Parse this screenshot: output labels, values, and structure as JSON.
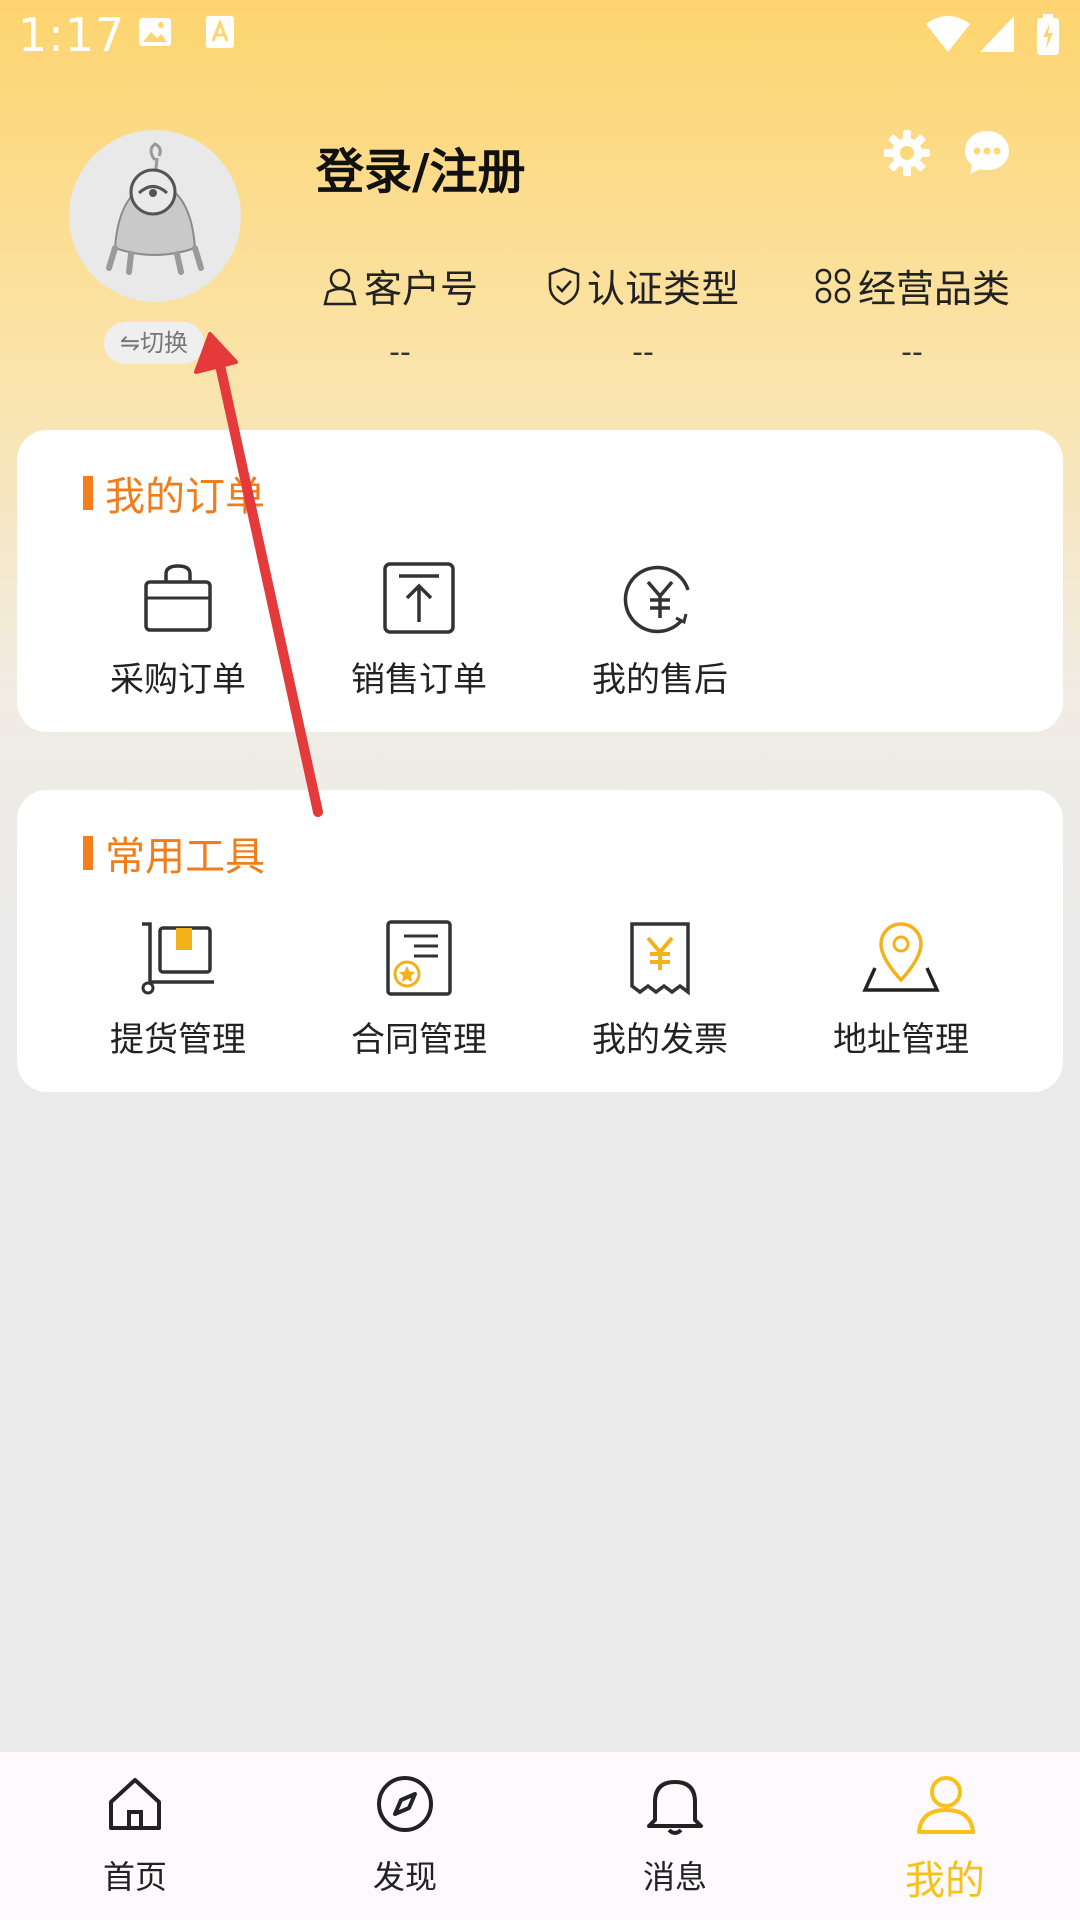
{
  "status_bar": {
    "time": "1:17"
  },
  "profile": {
    "login_label": "登录/注册",
    "switch_label": "⇋切换",
    "stats": [
      {
        "label": "客户号",
        "value": "--",
        "icon": "user-icon"
      },
      {
        "label": "认证类型",
        "value": "--",
        "icon": "shield-check-icon"
      },
      {
        "label": "经营品类",
        "value": "--",
        "icon": "grid-icon"
      }
    ]
  },
  "orders": {
    "title": "我的订单",
    "items": [
      {
        "label": "采购订单",
        "icon": "bag-icon"
      },
      {
        "label": "销售订单",
        "icon": "upload-icon"
      },
      {
        "label": "我的售后",
        "icon": "yuan-refresh-icon"
      }
    ]
  },
  "tools": {
    "title": "常用工具",
    "items": [
      {
        "label": "提货管理",
        "icon": "cart-box-icon"
      },
      {
        "label": "合同管理",
        "icon": "contract-icon"
      },
      {
        "label": "我的发票",
        "icon": "invoice-icon"
      },
      {
        "label": "地址管理",
        "icon": "map-pin-icon"
      }
    ]
  },
  "tabbar": {
    "items": [
      {
        "label": "首页",
        "icon": "home-icon"
      },
      {
        "label": "发现",
        "icon": "compass-icon"
      },
      {
        "label": "消息",
        "icon": "bell-icon"
      },
      {
        "label": "我的",
        "icon": "person-icon",
        "active": true
      }
    ]
  },
  "colors": {
    "accent": "#f6c21a",
    "section_title": "#f07d1a",
    "annotation_arrow": "#e43a3c"
  }
}
